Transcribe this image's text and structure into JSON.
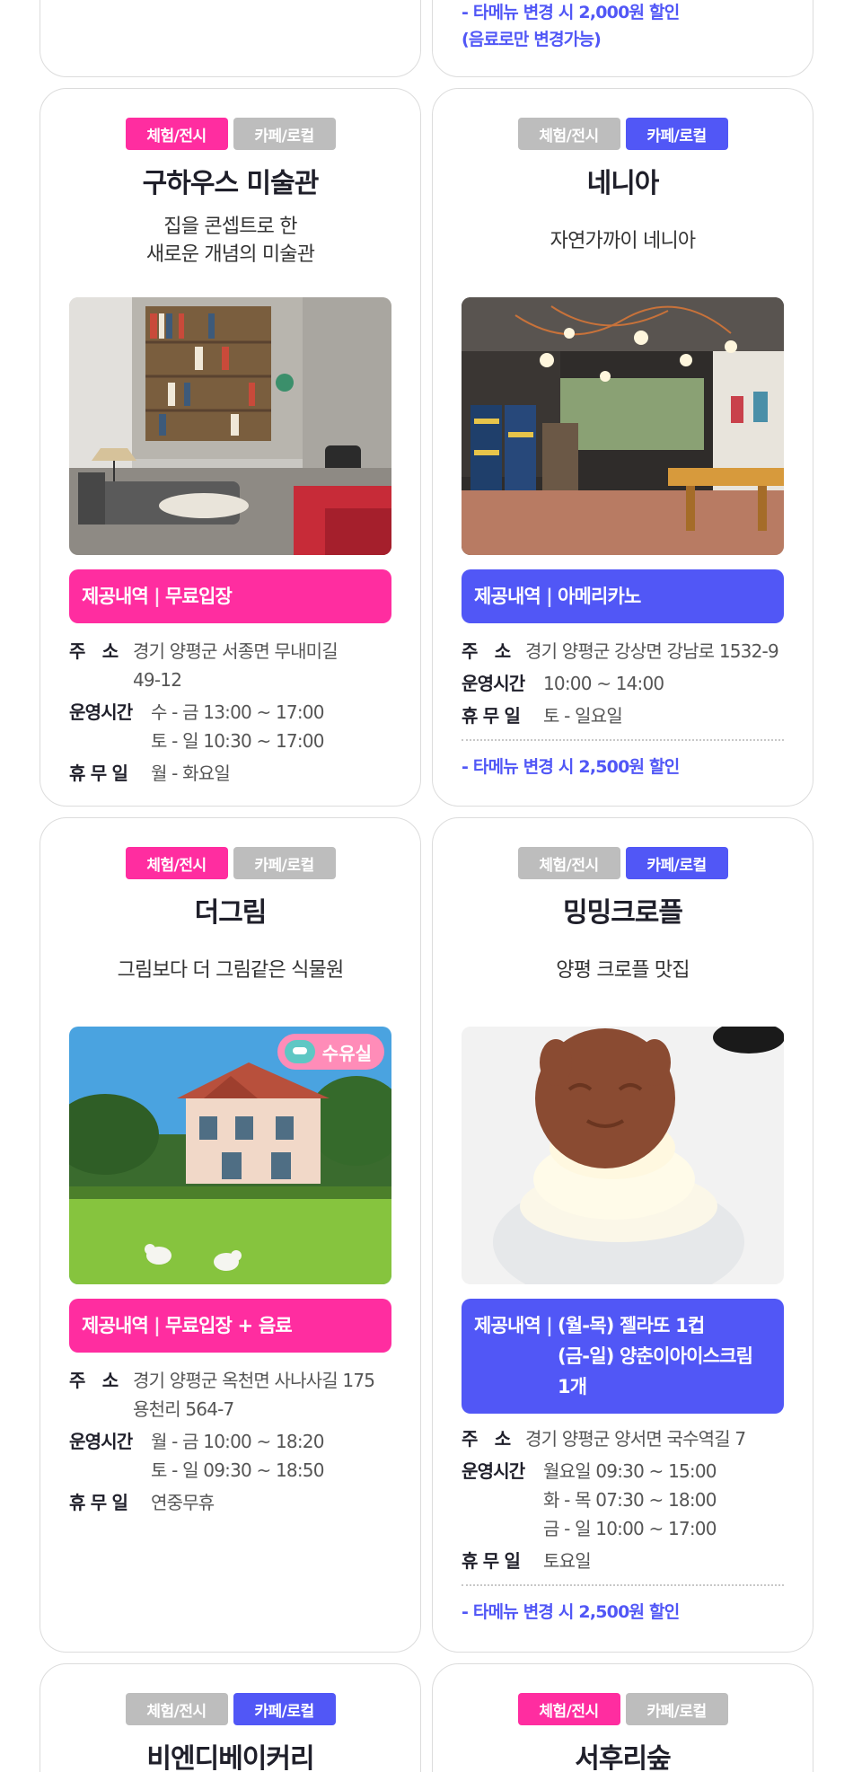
{
  "top": {
    "note_line1": "- 타메뉴 변경 시 2,000원 할인",
    "note_line2": "(음료로만 변경가능)"
  },
  "cards": [
    {
      "tags": [
        "체험/전시",
        "카페/로컬"
      ],
      "active_tag": 0,
      "title": "구하우스 미술관",
      "subtitle_line1": "집을 콘셉트로 한",
      "subtitle_line2": "새로운 개념의 미술관",
      "image": "library-living-room-photo",
      "offer_label": "제공내역",
      "offer_line1": "무료입장",
      "address_key": "주　소",
      "address_line1": "경기 양평군 서종면 무내미길",
      "address_line2": "49-12",
      "hours_key": "운영시간",
      "hours_line1": "수 - 금 13:00 ~ 17:00",
      "hours_line2": "토 - 일 10:30 ~ 17:00",
      "closed_key": "휴 무 일",
      "closed": "월 - 화요일"
    },
    {
      "tags": [
        "체험/전시",
        "카페/로컬"
      ],
      "active_tag": 1,
      "title": "네니아",
      "subtitle_line1": "자연가까이 네니아",
      "image": "cafe-interior-photo",
      "offer_label": "제공내역",
      "offer_line1": "아메리카노",
      "address_key": "주　소",
      "address_line1": "경기 양평군 강상면 강남로 1532-9",
      "hours_key": "운영시간",
      "hours_line1": "10:00 ~ 14:00",
      "closed_key": "휴 무 일",
      "closed": "토 - 일요일",
      "note": "- 타메뉴 변경 시 2,500원 할인"
    },
    {
      "tags": [
        "체험/전시",
        "카페/로컬"
      ],
      "active_tag": 0,
      "title": "더그림",
      "subtitle_line1": "그림보다 더 그림같은 식물원",
      "image": "garden-house-photo",
      "badge": "수유실",
      "offer_label": "제공내역",
      "offer_line1": "무료입장 + 음료",
      "address_key": "주　소",
      "address_line1": "경기 양평군 옥천면 사나사길 175",
      "address_line2": "용천리 564-7",
      "hours_key": "운영시간",
      "hours_line1": "월 - 금 10:00 ~ 18:20",
      "hours_line2": "토 - 일 09:30 ~ 18:50",
      "closed_key": "휴 무 일",
      "closed": "연중무휴"
    },
    {
      "tags": [
        "체험/전시",
        "카페/로컬"
      ],
      "active_tag": 1,
      "title": "밍밍크로플",
      "subtitle_line1": "양평 크로플 맛집",
      "image": "ice-cream-cookie-photo",
      "offer_label": "제공내역",
      "offer_line1": "(월-목) 젤라또 1컵",
      "offer_line2": "(금-일) 양춘이아이스크림",
      "offer_line3": "1개",
      "address_key": "주　소",
      "address_line1": "경기 양평군 양서면 국수역길 7",
      "hours_key": "운영시간",
      "hours_line1": "월요일 09:30 ~ 15:00",
      "hours_line2": "화 - 목 07:30 ~ 18:00",
      "hours_line3": "금 - 일 10:00 ~ 17:00",
      "closed_key": "휴 무 일",
      "closed": "토요일",
      "note": "- 타메뉴 변경 시 2,500원 할인"
    },
    {
      "tags": [
        "체험/전시",
        "카페/로컬"
      ],
      "active_tag": 1,
      "title": "비엔디베이커리"
    },
    {
      "tags": [
        "체험/전시",
        "카페/로컬"
      ],
      "active_tag": 0,
      "title": "서후리숲"
    }
  ],
  "colors": {
    "pink": "#ff2da0",
    "blue": "#5157f6",
    "gray_tag": "#bdbdbd",
    "card_border": "#dcdcdc",
    "title_text": "#1f1f2a"
  }
}
